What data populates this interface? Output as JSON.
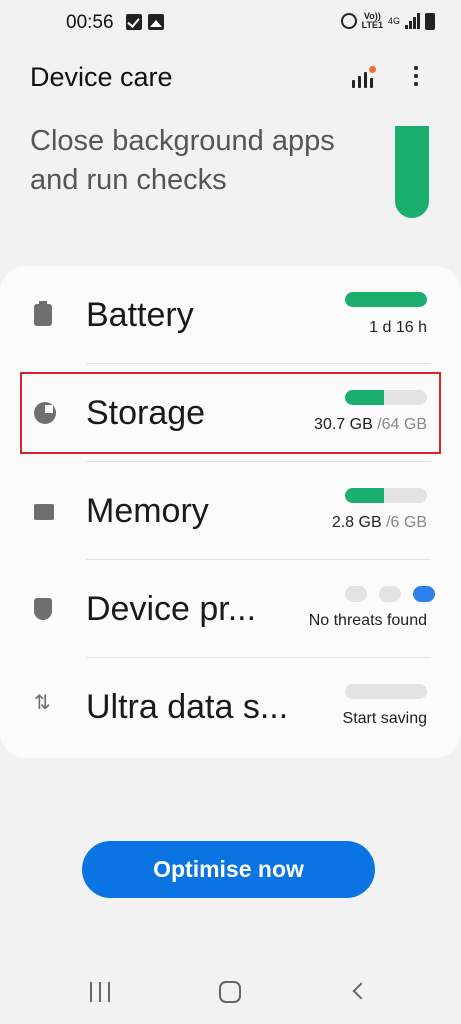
{
  "status_bar": {
    "time": "00:56",
    "network_type": "4G",
    "volte_label": "Vo))",
    "lte_label": "LTE1"
  },
  "header": {
    "title": "Device care"
  },
  "summary": {
    "message": "Close background apps and run checks"
  },
  "items": [
    {
      "label": "Battery",
      "value": "1 d 16 h",
      "value_secondary": "",
      "fill_fraction": 1.0
    },
    {
      "label": "Storage",
      "value": "30.7 GB",
      "value_secondary": " /64 GB",
      "fill_fraction": 0.48
    },
    {
      "label": "Memory",
      "value": "2.8 GB",
      "value_secondary": " /6 GB",
      "fill_fraction": 0.47
    },
    {
      "label": "Device pr...",
      "value": "No threats found",
      "value_secondary": "",
      "status_dots": 3,
      "active_dot": 3
    },
    {
      "label": "Ultra data s...",
      "value": "Start saving",
      "value_secondary": "",
      "fill_fraction": 0.0
    }
  ],
  "primary_action": {
    "label": "Optimise now"
  },
  "colors": {
    "accent_green": "#1aae6f",
    "button_blue": "#0a74e3",
    "highlight_red": "#d9252a",
    "dot_blue": "#2f7ff0"
  }
}
